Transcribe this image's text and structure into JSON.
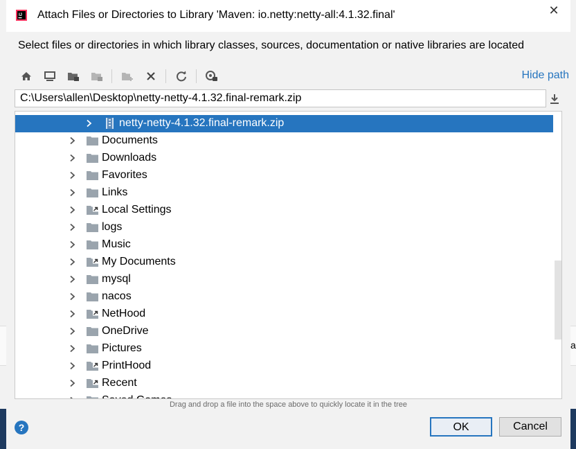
{
  "window": {
    "title": "Attach Files or Directories to Library 'Maven: io.netty:netty-all:4.1.32.final'",
    "close_glyph": "✕"
  },
  "description": "Select files or directories in which library classes, sources, documentation or native libraries are located",
  "toolbar": {
    "buttons": [
      "home-icon",
      "desktop-icon",
      "project-folder-icon",
      "module-folder-icon",
      "new-folder-icon",
      "delete-icon",
      "refresh-icon",
      "show-hidden-icon"
    ],
    "hide_path_label": "Hide path"
  },
  "path_field": {
    "value": "C:\\Users\\allen\\Desktop\\netty-netty-4.1.32.final-remark.zip"
  },
  "tree": {
    "selected": {
      "label": "netty-netty-4.1.32.final-remark.zip",
      "icon": "zip-archive-icon"
    },
    "items": [
      {
        "label": "Documents",
        "icon": "folder-icon"
      },
      {
        "label": "Downloads",
        "icon": "folder-icon"
      },
      {
        "label": "Favorites",
        "icon": "folder-icon"
      },
      {
        "label": "Links",
        "icon": "folder-icon"
      },
      {
        "label": "Local Settings",
        "icon": "folder-link-icon"
      },
      {
        "label": "logs",
        "icon": "folder-icon"
      },
      {
        "label": "Music",
        "icon": "folder-icon"
      },
      {
        "label": "My Documents",
        "icon": "folder-link-icon"
      },
      {
        "label": "mysql",
        "icon": "folder-icon"
      },
      {
        "label": "nacos",
        "icon": "folder-icon"
      },
      {
        "label": "NetHood",
        "icon": "folder-link-icon"
      },
      {
        "label": "OneDrive",
        "icon": "folder-icon"
      },
      {
        "label": "Pictures",
        "icon": "folder-icon"
      },
      {
        "label": "PrintHood",
        "icon": "folder-link-icon"
      },
      {
        "label": "Recent",
        "icon": "folder-link-icon"
      },
      {
        "label": "Saved Games",
        "icon": "folder-icon"
      }
    ]
  },
  "hint": "Drag and drop a file into the space above to quickly locate it in the tree",
  "buttons": {
    "help": "?",
    "ok": "OK",
    "cancel": "Cancel"
  },
  "colors": {
    "accent": "#2675bf",
    "folder": "#9aa4ad",
    "background": "#f2f2f2"
  },
  "edge_text": "ar"
}
